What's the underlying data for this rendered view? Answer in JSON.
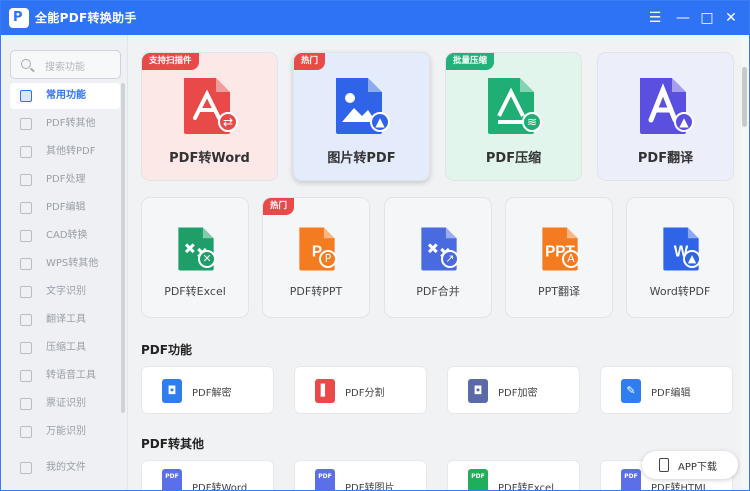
{
  "app": {
    "title": "全能PDF转换助手",
    "logo_letter": "P"
  },
  "window": {
    "menu_icon": "☰",
    "minimize_icon": "—",
    "maximize_icon": "□",
    "close_icon": "✕"
  },
  "sidebar": {
    "search_placeholder": "搜索功能",
    "items": [
      {
        "label": "常用功能",
        "active": true
      },
      {
        "label": "PDF转其他"
      },
      {
        "label": "其他转PDF"
      },
      {
        "label": "PDF处理"
      },
      {
        "label": "PDF编辑"
      },
      {
        "label": "CAD转换"
      },
      {
        "label": "WPS转其他"
      },
      {
        "label": "文字识别"
      },
      {
        "label": "翻译工具"
      },
      {
        "label": "压缩工具"
      },
      {
        "label": "转语音工具"
      },
      {
        "label": "票证识别"
      },
      {
        "label": "万能识别"
      },
      {
        "label": "我的文件"
      }
    ]
  },
  "featured": [
    {
      "label": "PDF转Word",
      "tag": "支持扫描件",
      "tag_color": "#e84a4a",
      "bg": "#fde8e8",
      "icon_color": "#e84a4a"
    },
    {
      "label": "图片转PDF",
      "tag": "热门",
      "tag_color": "#e84a4a",
      "bg": "#e4ecfb",
      "icon_color": "#2f63e8"
    },
    {
      "label": "PDF压缩",
      "tag": "批量压缩",
      "tag_color": "#20b27a",
      "bg": "#e1f5ec",
      "icon_color": "#1fae74"
    },
    {
      "label": "PDF翻译",
      "tag": "",
      "tag_color": "",
      "bg": "#eceefa",
      "icon_color": "#5b4fe0"
    }
  ],
  "secondary": [
    {
      "label": "PDF转Excel",
      "tag": "",
      "icon_color": "#1f9e6a",
      "icon_text": ""
    },
    {
      "label": "PDF转PPT",
      "tag": "热门",
      "icon_color": "#f47b20",
      "icon_text": ""
    },
    {
      "label": "PDF合并",
      "tag": "",
      "icon_color": "#4a6be0",
      "icon_text": ""
    },
    {
      "label": "PPT翻译",
      "tag": "",
      "icon_color": "#f47b20",
      "icon_text": "PPT"
    },
    {
      "label": "Word转PDF",
      "tag": "",
      "icon_color": "#2f63e8",
      "icon_text": "W"
    }
  ],
  "pdf_functions": {
    "title": "PDF功能",
    "items": [
      {
        "label": "PDF解密",
        "icon_color": "#2f7ef0"
      },
      {
        "label": "PDF分割",
        "icon_color": "#e84a4a"
      },
      {
        "label": "PDF加密",
        "icon_color": "#5a6aa8"
      },
      {
        "label": "PDF编辑",
        "icon_color": "#2f7ef0"
      }
    ]
  },
  "pdf_to_other": {
    "title": "PDF转其他",
    "items": [
      {
        "label": "PDF转Word",
        "icon_color": "#5b6fe8"
      },
      {
        "label": "PDF转图片",
        "icon_color": "#5b6fe8"
      },
      {
        "label": "PDF转Excel",
        "icon_color": "#1fae5a"
      },
      {
        "label": "PDF转HTML",
        "icon_color": "#5b6fe8"
      }
    ],
    "icon_text": "PDF"
  },
  "app_download": {
    "label": "APP下载"
  }
}
